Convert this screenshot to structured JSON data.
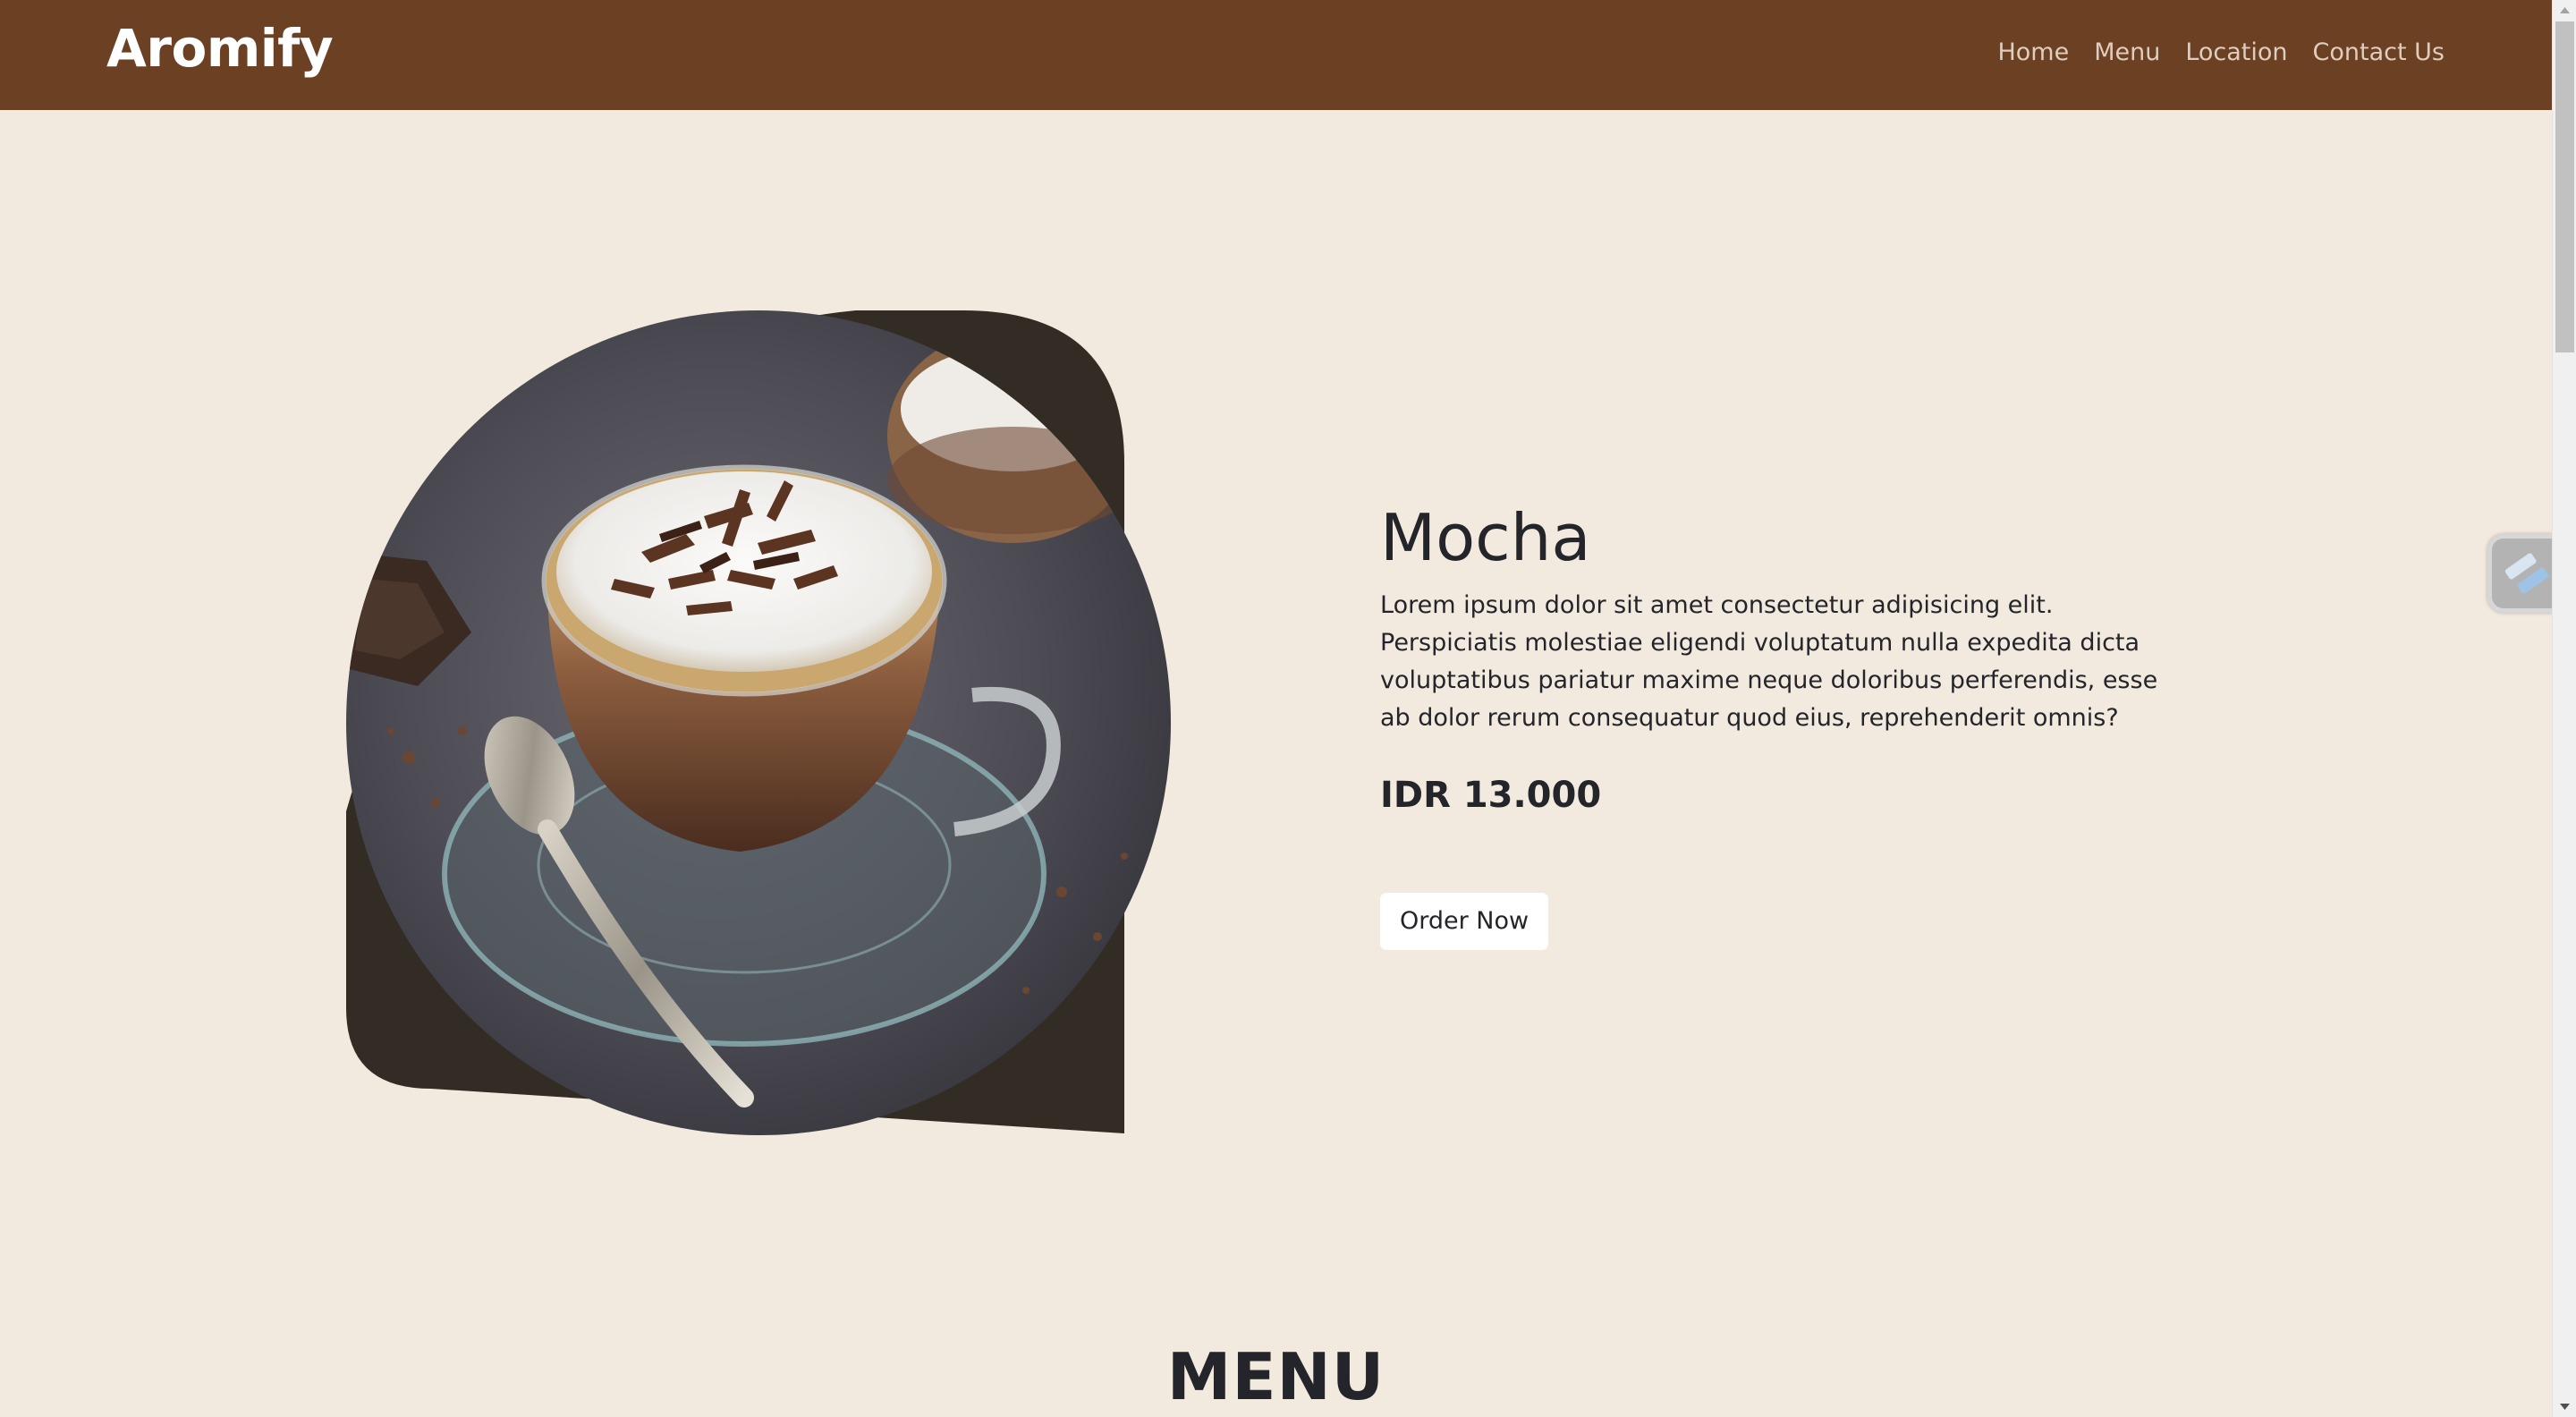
{
  "brand": "Aromify",
  "nav": {
    "items": [
      "Home",
      "Menu",
      "Location",
      "Contact Us"
    ]
  },
  "hero": {
    "title": "Mocha",
    "description": "Lorem ipsum dolor sit amet consectetur adipisicing elit. Perspiciatis molestiae eligendi voluptatum nulla expedita dicta voluptatibus pariatur maxime neque doloribus perferendis, esse ab dolor rerum consequatur quod eius, reprehenderit omnis?",
    "price": "IDR 13.000",
    "order_label": "Order Now",
    "image_icon": "mocha-coffee-image"
  },
  "menu_section": {
    "heading": "MENU"
  },
  "colors": {
    "background": "#f2e9df",
    "navbar": "#6b4023",
    "nav_link": "#e0cdbd",
    "dark_blob": "#332c25",
    "text": "#24252a"
  },
  "widget_icon": "lightning-bolt-icon"
}
